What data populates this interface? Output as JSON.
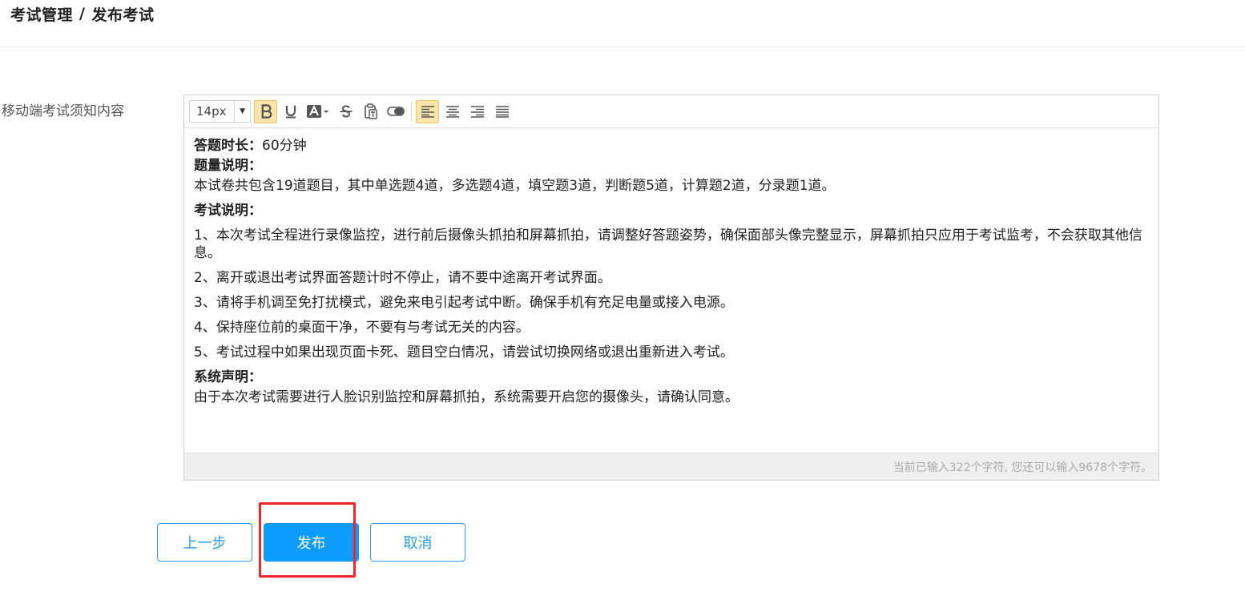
{
  "breadcrumb": {
    "parent": "考试管理",
    "separator": "/",
    "current": "发布考试"
  },
  "form": {
    "label": "移动端考试须知内容"
  },
  "toolbar": {
    "font_size": "14px",
    "buttons": [
      "bold-icon",
      "underline-icon",
      "font-color-icon",
      "strikethrough-icon",
      "paste-text-icon",
      "clear-format-icon",
      "align-left-icon",
      "align-center-icon",
      "align-right-icon",
      "align-justify-icon"
    ]
  },
  "content": {
    "duration_label": "答题时长：",
    "duration_value": "60分钟",
    "count_heading": "题量说明：",
    "count_text": "本试卷共包含19道题目，其中单选题4道，多选题4道，填空题3道，判断题5道，计算题2道，分录题1道。",
    "rules_heading": "考试说明：",
    "rules": [
      "1、本次考试全程进行录像监控，进行前后摄像头抓拍和屏幕抓拍，请调整好答题姿势，确保面部头像完整显示，屏幕抓拍只应用于考试监考，不会获取其他信息。",
      "2、离开或退出考试界面答题计时不停止，请不要中途离开考试界面。",
      "3、请将手机调至免打扰模式，避免来电引起考试中断。确保手机有充足电量或接入电源。",
      "4、保持座位前的桌面干净，不要有与考试无关的内容。",
      "5、考试过程中如果出现页面卡死、题目空白情况，请尝试切换网络或退出重新进入考试。"
    ],
    "statement_heading": "系统声明：",
    "statement_text": "由于本次考试需要进行人脸识别监控和屏幕抓拍，系统需要开启您的摄像头，请确认同意。"
  },
  "status": {
    "char_count": "当前已输入322个字符, 您还可以输入9678个字符。"
  },
  "actions": {
    "prev_label": "上一步",
    "publish_label": "发布",
    "cancel_label": "取消"
  },
  "colors": {
    "primary": "#0c9cfd",
    "highlight": "#f0262a",
    "toolbar_active": "#fbe5a8"
  }
}
